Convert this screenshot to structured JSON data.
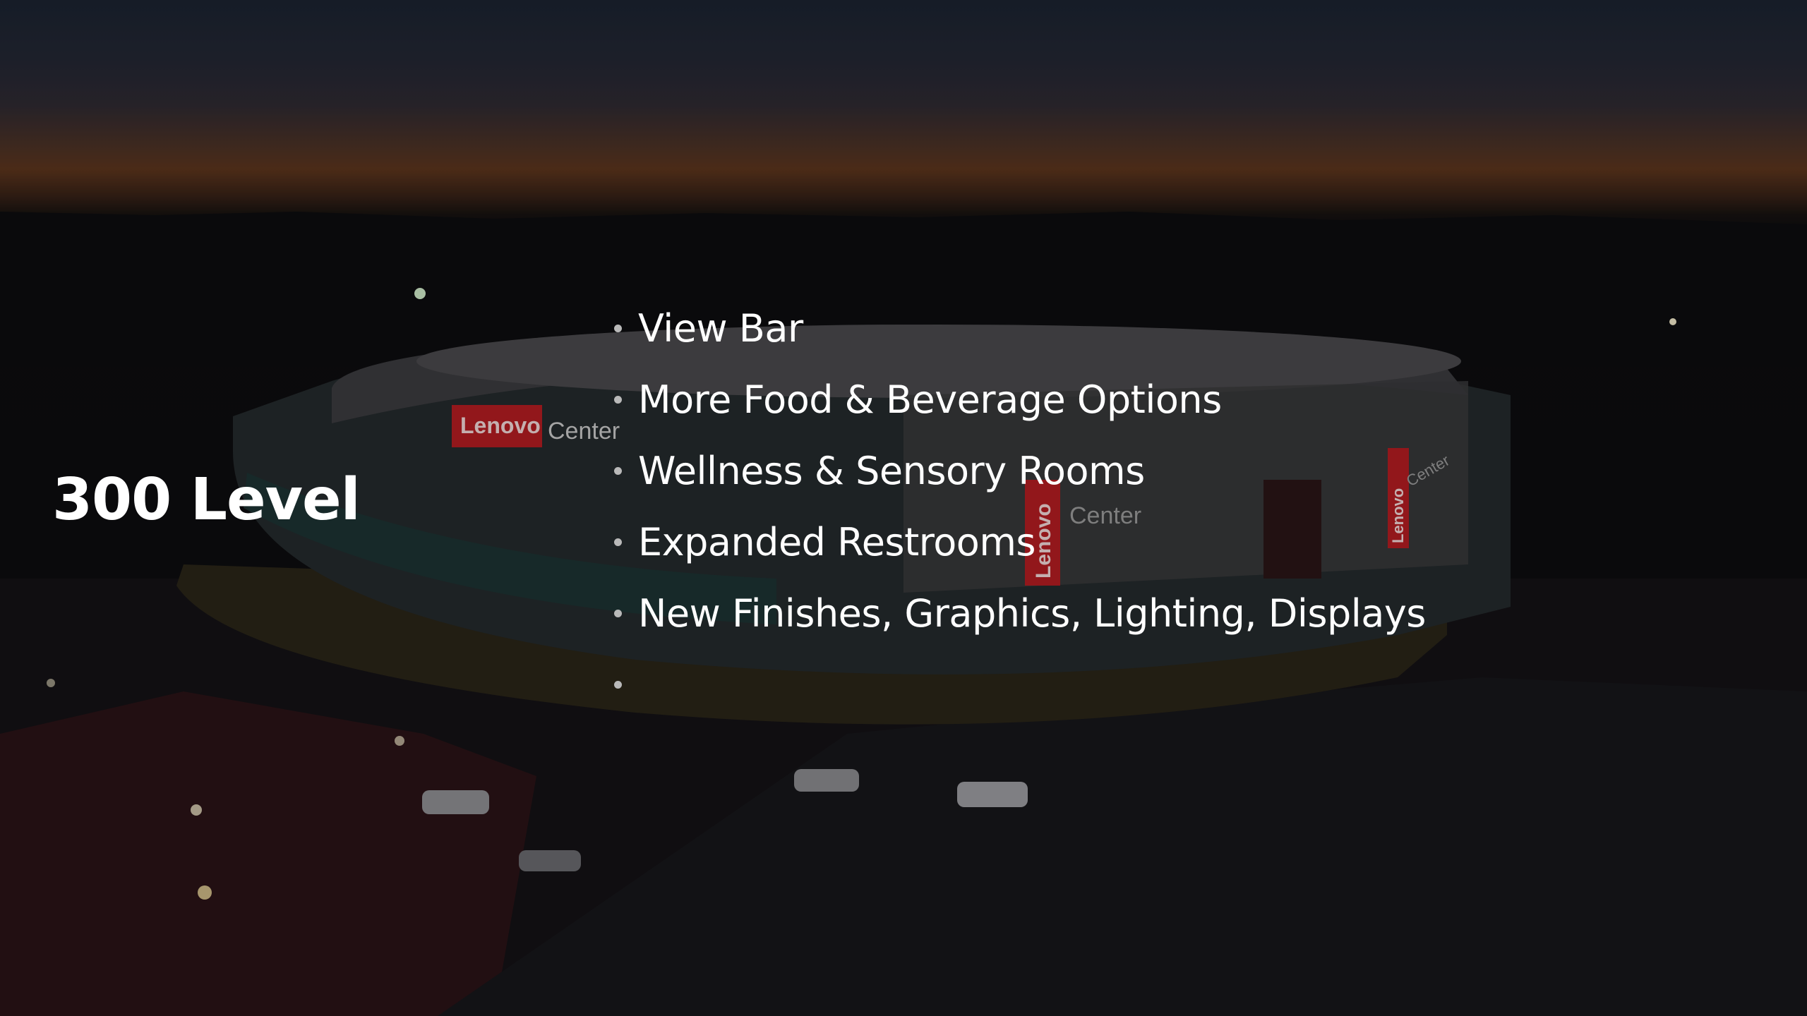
{
  "slide": {
    "title": "300 Level",
    "bullets": [
      {
        "text": "View Bar"
      },
      {
        "text": "More Food & Beverage Options"
      },
      {
        "text": "Wellness & Sensory Rooms"
      },
      {
        "text": "Expanded Restrooms"
      },
      {
        "text": "New Finishes, Graphics, Lighting, Displays"
      },
      {
        "text": ""
      }
    ]
  },
  "background": {
    "signage": [
      "Lenovo",
      "Center",
      "Lenovo",
      "Center",
      "Lenovo",
      "Center"
    ]
  },
  "colors": {
    "text": "#ffffff",
    "bullet_dot": "#b9b9b9",
    "sign_red": "#b31d22"
  }
}
